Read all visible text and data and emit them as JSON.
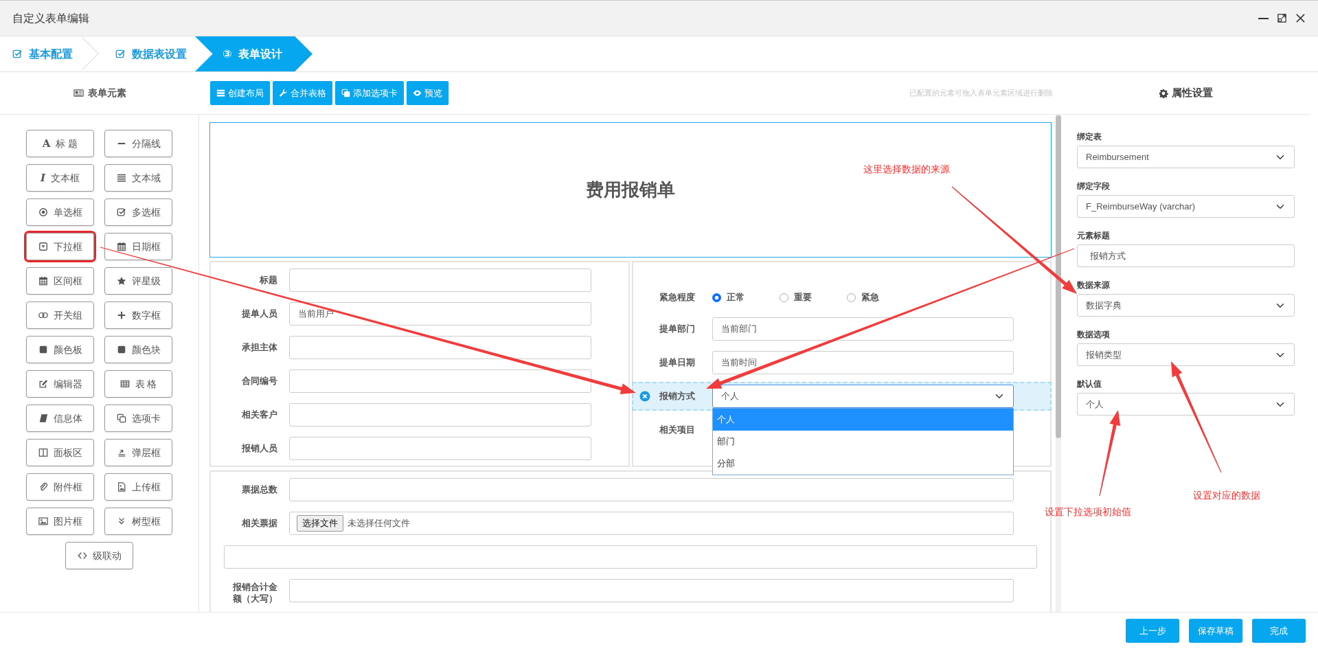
{
  "window": {
    "title": "自定义表单编辑"
  },
  "steps": [
    {
      "label": "基本配置",
      "done": true,
      "selected": false
    },
    {
      "label": "数据表设置",
      "done": true,
      "selected": false
    },
    {
      "label": "表单设计",
      "number": "③",
      "done": false,
      "selected": true
    }
  ],
  "elements_panel": {
    "title": "表单元素",
    "items": [
      {
        "label": "标 题",
        "glyph": "A",
        "highlighted": false
      },
      {
        "label": "分隔线",
        "highlighted": false
      },
      {
        "label": "文本框",
        "glyph": "I",
        "highlighted": false
      },
      {
        "label": "文本域",
        "highlighted": false
      },
      {
        "label": "单选框",
        "highlighted": false
      },
      {
        "label": "多选框",
        "highlighted": false
      },
      {
        "label": "下拉框",
        "highlighted": true
      },
      {
        "label": "日期框",
        "highlighted": false
      },
      {
        "label": "区间框",
        "highlighted": false
      },
      {
        "label": "评星级",
        "highlighted": false
      },
      {
        "label": "开关组",
        "highlighted": false
      },
      {
        "label": "数字框",
        "highlighted": false
      },
      {
        "label": "颜色板",
        "highlighted": false
      },
      {
        "label": "颜色块",
        "highlighted": false
      },
      {
        "label": "编辑器",
        "highlighted": false
      },
      {
        "label": "表 格",
        "highlighted": false
      },
      {
        "label": "信息体",
        "highlighted": false
      },
      {
        "label": "选项卡",
        "highlighted": false
      },
      {
        "label": "面板区",
        "highlighted": false
      },
      {
        "label": "弹层框",
        "highlighted": false
      },
      {
        "label": "附件框",
        "highlighted": false
      },
      {
        "label": "上传框",
        "highlighted": false
      },
      {
        "label": "图片框",
        "highlighted": false
      },
      {
        "label": "树型框",
        "highlighted": false
      },
      {
        "label": "级联动",
        "highlighted": false
      }
    ]
  },
  "toolbar": {
    "buttons": [
      "创建布局",
      "合并表格",
      "添加选项卡",
      "预览"
    ],
    "hint": "已配置的元素可拖入表单元素区域进行删除"
  },
  "form": {
    "title": "费用报销单",
    "left_fields": [
      {
        "label": "标题"
      },
      {
        "label": "提单人员",
        "value": "当前用户"
      },
      {
        "label": "承担主体"
      },
      {
        "label": "合同编号"
      },
      {
        "label": "相关客户"
      },
      {
        "label": "报销人员"
      }
    ],
    "right_fields": [
      {
        "kind": "radio",
        "label": "紧急程度",
        "selected": false,
        "options": [
          {
            "label": "正常",
            "selected": true
          },
          {
            "label": "重要",
            "selected": false
          },
          {
            "label": "紧急",
            "selected": false
          }
        ]
      },
      {
        "kind": "input",
        "label": "提单部门",
        "value": "当前部门",
        "selected": false
      },
      {
        "kind": "input",
        "label": "提单日期",
        "value": "当前时间",
        "selected": false
      },
      {
        "kind": "select",
        "label": "报销方式",
        "value": "个人",
        "selected": true,
        "expanded": true,
        "options": [
          {
            "label": "个人",
            "selected": true
          },
          {
            "label": "部门",
            "selected": false
          },
          {
            "label": "分部",
            "selected": false
          }
        ]
      },
      {
        "kind": "label",
        "label": "相关项目",
        "selected": false
      }
    ],
    "bottom_fields": [
      {
        "kind": "input",
        "label": "票据总数"
      },
      {
        "kind": "file",
        "label": "相关票据",
        "button": "选择文件",
        "status": "未选择任何文件"
      },
      {
        "kind": "blank"
      },
      {
        "kind": "input",
        "label": "报销合计金额（大写）"
      }
    ]
  },
  "properties": {
    "title": "属性设置",
    "fields": [
      {
        "label": "绑定表",
        "kind": "select",
        "value": "Reimbursement"
      },
      {
        "label": "绑定字段",
        "kind": "select",
        "value": "F_ReimburseWay (varchar)"
      },
      {
        "label": "元素标题",
        "kind": "input",
        "value": "报销方式"
      },
      {
        "label": "数据来源",
        "kind": "select",
        "value": "数据字典"
      },
      {
        "label": "数据选项",
        "kind": "select",
        "value": "报销类型"
      },
      {
        "label": "默认值",
        "kind": "select",
        "value": "个人"
      }
    ]
  },
  "annotations": [
    {
      "text": "这里选择数据的来源"
    },
    {
      "text": "设置下拉选项初始值"
    },
    {
      "text": "设置对应的数据"
    }
  ],
  "footer": {
    "buttons": [
      "上一步",
      "保存草稿",
      "完成"
    ]
  }
}
